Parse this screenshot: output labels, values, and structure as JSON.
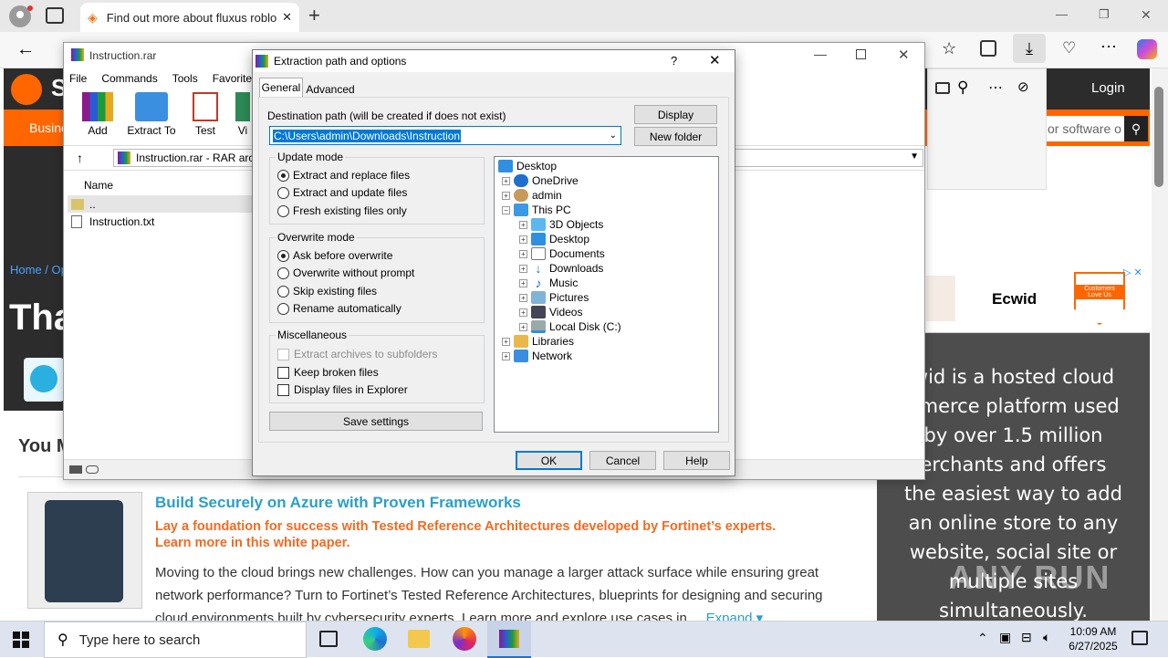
{
  "browser": {
    "tab_title": "Find out more about fluxus roblo",
    "tab_close": "✕",
    "new_tab": "+",
    "window_min": "—",
    "window_max": "❐",
    "window_close": "✕"
  },
  "site": {
    "logo_partial": "S",
    "nav_partial": "Busine",
    "login": "Login",
    "search_partial": "or software o",
    "breadcrumb_home": "Home",
    "breadcrumb_partial": "Op",
    "hero_partial": "Tha",
    "you_partial": "You M",
    "ad_brand": "Ecwid",
    "ad_badge_top": "SOURCEFORGE",
    "ad_badge_main": "Customers Love Us",
    "ecwid_text": "wid is a hosted cloud\nnmerce platform used\nby over 1.5 million\nerchants and offers\nthe easiest way to add\nan online store to any\nwebsite, social site or\nmultiple sites\nsimultaneously.",
    "article_title": "Build Securely on Azure with Proven Frameworks",
    "article_lead": "Lay a foundation for success with Tested Reference Architectures developed by Fortinet’s experts. Learn more in this white paper.",
    "article_body": "Moving to the cloud brings new challenges. How can you manage a larger attack surface while ensuring great network performance? Turn to Fortinet’s Tested Reference Architectures, blueprints for designing and securing cloud environments built by cybersecurity experts. Learn more and explore use cases in",
    "article_expand": "... Expand ▾",
    "watermark": "ANY RUN"
  },
  "rar": {
    "title": "Instruction.rar",
    "menu": [
      "File",
      "Commands",
      "Tools",
      "Favorites"
    ],
    "toolbar": [
      "Add",
      "Extract To",
      "Test",
      "Vi"
    ],
    "path": "Instruction.rar - RAR arc",
    "col_name": "Name",
    "files": [
      "..",
      "Instruction.txt"
    ]
  },
  "dialog": {
    "title": "Extraction path and options",
    "help_glyph": "?",
    "close_glyph": "✕",
    "tabs": [
      "General",
      "Advanced"
    ],
    "dest_label": "Destination path (will be created if does not exist)",
    "dest_value": "C:\\Users\\admin\\Downloads\\Instruction",
    "display_btn": "Display",
    "new_folder_btn": "New folder",
    "update_mode": {
      "title": "Update mode",
      "options": [
        "Extract and replace files",
        "Extract and update files",
        "Fresh existing files only"
      ],
      "selected": 0
    },
    "overwrite_mode": {
      "title": "Overwrite mode",
      "options": [
        "Ask before overwrite",
        "Overwrite without prompt",
        "Skip existing files",
        "Rename automatically"
      ],
      "selected": 0
    },
    "misc": {
      "title": "Miscellaneous",
      "options": [
        "Extract archives to subfolders",
        "Keep broken files",
        "Display files in Explorer"
      ]
    },
    "save_settings": "Save settings",
    "tree": [
      "Desktop",
      "OneDrive",
      "admin",
      "This PC",
      "3D Objects",
      "Desktop",
      "Documents",
      "Downloads",
      "Music",
      "Pictures",
      "Videos",
      "Local Disk (C:)",
      "Libraries",
      "Network"
    ],
    "ok": "OK",
    "cancel": "Cancel",
    "help": "Help"
  },
  "taskbar": {
    "search_placeholder": "Type here to search",
    "time": "10:09 AM",
    "date": "6/27/2025"
  }
}
